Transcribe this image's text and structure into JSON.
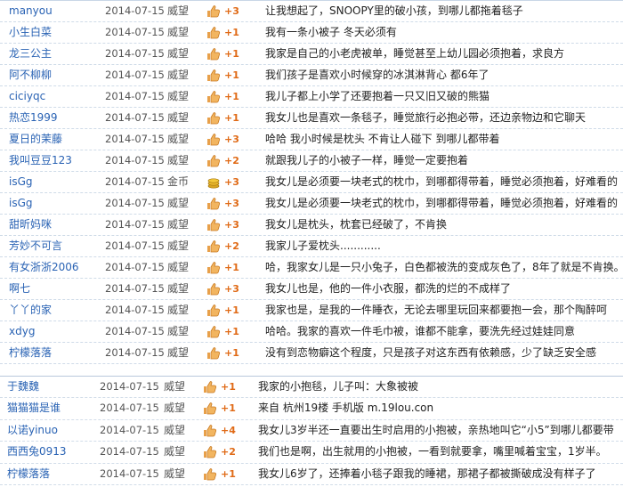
{
  "section1": {
    "rows": [
      {
        "user": "manyou",
        "date": "2014-07-15",
        "kind": "威望",
        "icon": "thumbs-up-icon",
        "points": "+3",
        "reason": "让我想起了，SNOOPY里的破小孩，到哪儿都拖着毯子"
      },
      {
        "user": "小生白菜",
        "date": "2014-07-15",
        "kind": "威望",
        "icon": "thumbs-up-icon",
        "points": "+1",
        "reason": "我有一条小被子 冬天必须有"
      },
      {
        "user": "龙三公主",
        "date": "2014-07-15",
        "kind": "威望",
        "icon": "thumbs-up-icon",
        "points": "+1",
        "reason": "我家是自己的小老虎被单，睡觉甚至上幼儿园必须抱着，求良方"
      },
      {
        "user": "阿不柳柳",
        "date": "2014-07-15",
        "kind": "威望",
        "icon": "thumbs-up-icon",
        "points": "+1",
        "reason": "我们孩子是喜欢小时候穿的冰淇淋背心  都6年了"
      },
      {
        "user": "ciciyqc",
        "date": "2014-07-15",
        "kind": "威望",
        "icon": "thumbs-up-icon",
        "points": "+1",
        "reason": "我儿子都上小学了还要抱着一只又旧又破的熊猫"
      },
      {
        "user": "热恋1999",
        "date": "2014-07-15",
        "kind": "威望",
        "icon": "thumbs-up-icon",
        "points": "+1",
        "reason": "我女儿也是喜欢一条毯子，睡觉旅行必抱必带，还边亲物边和它聊天"
      },
      {
        "user": "夏日的茉藤",
        "date": "2014-07-15",
        "kind": "威望",
        "icon": "thumbs-up-icon",
        "points": "+3",
        "reason": "哈哈  我小时候是枕头  不肯让人碰下  到哪儿都带着"
      },
      {
        "user": "我叫豆豆123",
        "date": "2014-07-15",
        "kind": "威望",
        "icon": "thumbs-up-icon",
        "points": "+2",
        "reason": "就跟我儿子的小被子一样，睡觉一定要抱着"
      },
      {
        "user": "isGg",
        "date": "2014-07-15",
        "kind": "金币",
        "icon": "coins-icon",
        "points": "+3",
        "reason": "我女儿是必须要一块老式的枕巾，到哪都得带着，睡觉必须抱着，好难看的"
      },
      {
        "user": "isGg",
        "date": "2014-07-15",
        "kind": "威望",
        "icon": "thumbs-up-icon",
        "points": "+3",
        "reason": "我女儿是必须要一块老式的枕巾，到哪都得带着，睡觉必须抱着，好难看的"
      },
      {
        "user": "甜昕妈咪",
        "date": "2014-07-15",
        "kind": "威望",
        "icon": "thumbs-up-icon",
        "points": "+3",
        "reason": "我女儿是枕头，枕套已经破了，不肯换"
      },
      {
        "user": "芳妙不可言",
        "date": "2014-07-15",
        "kind": "威望",
        "icon": "thumbs-up-icon",
        "points": "+2",
        "reason": "我家儿子爱枕头............"
      },
      {
        "user": "有女浙浙2006",
        "date": "2014-07-15",
        "kind": "威望",
        "icon": "thumbs-up-icon",
        "points": "+1",
        "reason": "哈，我家女儿是一只小兔子，白色都被洗的变成灰色了，8年了就是不肯换。"
      },
      {
        "user": "啊七",
        "date": "2014-07-15",
        "kind": "威望",
        "icon": "thumbs-up-icon",
        "points": "+3",
        "reason": "我女儿也是，他的一件小衣服，都洗的烂的不成样了"
      },
      {
        "user": "丫丫的家",
        "date": "2014-07-15",
        "kind": "威望",
        "icon": "thumbs-up-icon",
        "points": "+1",
        "reason": "我家也是，是我的一件睡衣，无论去哪里玩回来都要抱一会，那个陶醉呵"
      },
      {
        "user": "xdyg",
        "date": "2014-07-15",
        "kind": "威望",
        "icon": "thumbs-up-icon",
        "points": "+1",
        "reason": "哈哈。我家的喜欢一件毛巾被，谁都不能拿，要洗先经过娃娃同意"
      },
      {
        "user": "柠檬落落",
        "date": "2014-07-15",
        "kind": "威望",
        "icon": "thumbs-up-icon",
        "points": "+1",
        "reason": "没有到恋物癖这个程度，只是孩子对这东西有依赖感，少了缺乏安全感"
      }
    ]
  },
  "section2": {
    "rows": [
      {
        "user": "于魏魏",
        "date": "2014-07-15",
        "kind": "威望",
        "icon": "thumbs-up-icon",
        "points": "+1",
        "reason": "我家的小抱毯，儿子叫：大象被被"
      },
      {
        "user": "猫猫猫是谁",
        "date": "2014-07-15",
        "kind": "威望",
        "icon": "thumbs-up-icon",
        "points": "+1",
        "reason": "来自 杭州19楼 手机版 m.19lou.con"
      },
      {
        "user": "以诺yinuo",
        "date": "2014-07-15",
        "kind": "威望",
        "icon": "thumbs-up-icon",
        "points": "+4",
        "reason": "我女儿3岁半还一直要出生时启用的小抱被，亲热地叫它“小5”到哪儿都要带"
      },
      {
        "user": "西西兔0913",
        "date": "2014-07-15",
        "kind": "威望",
        "icon": "thumbs-up-icon",
        "points": "+2",
        "reason": "我们也是啊，出生就用的小抱被，一看到就要拿，嘴里喊着宝宝，1岁半。"
      },
      {
        "user": "柠檬落落",
        "date": "2014-07-15",
        "kind": "威望",
        "icon": "thumbs-up-icon",
        "points": "+1",
        "reason": "我女儿6岁了，还捧着小毯子跟我的睡裙，那裙子都被撕破成没有样子了"
      }
    ]
  },
  "colors": {
    "user": "#2a63b4",
    "points": "#e06a16",
    "divider": "#cfdbe8"
  }
}
